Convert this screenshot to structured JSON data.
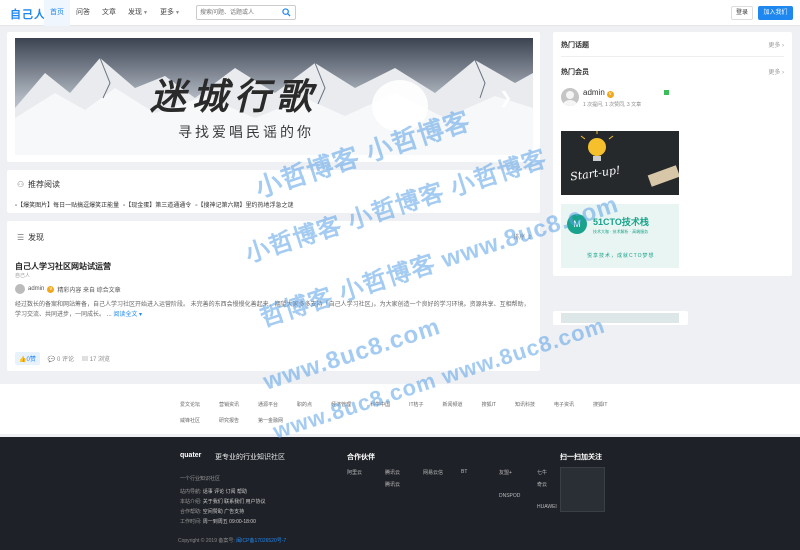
{
  "header": {
    "logo": "自己人",
    "nav": [
      {
        "label": "首页",
        "active": true,
        "dropdown": false
      },
      {
        "label": "问答",
        "active": false,
        "dropdown": false
      },
      {
        "label": "文章",
        "active": false,
        "dropdown": false
      },
      {
        "label": "发现",
        "active": false,
        "dropdown": true
      },
      {
        "label": "更多",
        "active": false,
        "dropdown": true
      }
    ],
    "search_placeholder": "搜索问题、话题或人",
    "login": "登录",
    "join": "加入我们"
  },
  "banner": {
    "title": "迷城行歌",
    "subtitle": "寻找爱唱民谣的你"
  },
  "recommended": {
    "title": "推荐阅读",
    "items": [
      "【爆笑图片】每日一贴搞逗爆笑正能量",
      "【现金蛋】第三道通通令",
      "【搜神记第六期】里约热地浮急之谜"
    ]
  },
  "discover": {
    "title": "发现",
    "sort": "排序",
    "post": {
      "title": "自己人学习社区网站试运营",
      "sub": "自己人",
      "author": "admin",
      "meta": "精彩内容 来自 综合文章",
      "body": "经过数长的备案和网站筹备，自己人学习社区开始进入运营阶段。 未完善的东西会慢慢化善起来，期望大家多多支持「自己人学习社区」。为大家创造一个良好的学习环境。资源共享、互相帮助，学习交流、共同进步，一同成长。",
      "more": "阅读全文",
      "likes": "0赞",
      "comments": "0 评论",
      "views": "17 浏览"
    }
  },
  "sidebar": {
    "hot_topics": "热门话题",
    "hot_members": "热门会员",
    "more": "更多",
    "member": {
      "name": "admin",
      "stats": "1 次提问, 1 次赞同, 3 文章"
    },
    "ad1_text": "Start-up!",
    "ad2": {
      "title": "51CTO技术栈",
      "sub": "技术大咖 · 技术解析 · 高端服务",
      "slogan": "悦享技术，成就CTO梦想"
    }
  },
  "links": {
    "row1": [
      "爱文论坛",
      "营销资讯",
      "通源平台",
      "职的点",
      "经济管理",
      "科学中国",
      "IT桔子",
      "新闻频道",
      "搜狐IT",
      "知讯科技",
      "电子资讯",
      "搜狐IT"
    ],
    "row2": [
      "威锋社区",
      "研究报告",
      "第一金融网"
    ]
  },
  "footer": {
    "logo": "quater",
    "slogan": "更专业的行业知识社区",
    "tagline": "一个行业知识社区",
    "lines": [
      {
        "label": "站内导航:",
        "value": "话事 评论 订阅 帮助"
      },
      {
        "label": "本站介绍:",
        "value": "关于我们 联系我们 用户协议"
      },
      {
        "label": "合作帮助:",
        "value": "空间赞助 广告支持"
      },
      {
        "label": "工作时间:",
        "value": "周一到周五 09:00-18:00"
      }
    ],
    "partners_title": "合作伙伴",
    "partners": [
      "阿里云",
      "腾讯云",
      "网易云信",
      "BT",
      "友盟+",
      "七牛",
      "",
      "腾讯云",
      "",
      "",
      "",
      "奇云",
      "",
      "",
      "",
      "",
      "DNSPOD",
      "",
      "",
      "",
      "",
      "",
      "",
      "HUAWEI"
    ],
    "qr_title": "扫一扫加关注",
    "copyright": "Copyright © 2019 备案号:",
    "icp": "闽ICP备17026520号-7"
  },
  "watermark": {
    "lines": [
      "小哲博客 小哲博客",
      "小哲博客 小哲博客 小哲博客",
      "哲博客 小哲博客 www.8uc8.com",
      "www.8uc8.com",
      "www.8uc8.com www.8uc8.com"
    ]
  }
}
